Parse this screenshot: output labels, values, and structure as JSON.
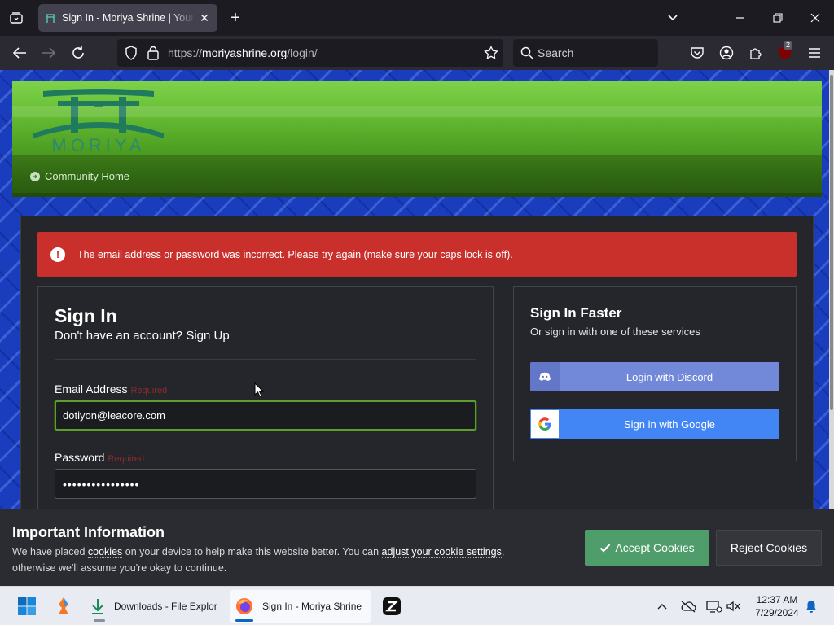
{
  "browser": {
    "tab_title": "Sign In - Moriya Shrine | Your re",
    "url_dim_prefix": "https://",
    "url_host": "moriyashrine.org",
    "url_path": "/login/",
    "search_placeholder": "Search",
    "extension_badge": "2"
  },
  "site": {
    "logo_text": "MORIYA",
    "breadcrumb": "Community Home",
    "brand_green": "#66bd33"
  },
  "alert": {
    "icon": "!",
    "message": "The email address or password was incorrect. Please try again (make sure your caps lock is off)."
  },
  "signin": {
    "title": "Sign In",
    "subtitle_prefix": "Don't have an account?",
    "signup_link": "Sign Up",
    "email_label": "Email Address",
    "email_required": "Required",
    "email_value": "dotiyon@leacore.com",
    "password_label": "Password",
    "password_required": "Required",
    "password_value": "••••••••••••••••"
  },
  "faster": {
    "title": "Sign In Faster",
    "subtitle": "Or sign in with one of these services",
    "discord_label": "Login with Discord",
    "google_label": "Sign in with Google"
  },
  "cookie": {
    "title": "Important Information",
    "text_1": "We have placed ",
    "link_cookies": "cookies",
    "text_2": " on your device to help make this website better. You can ",
    "link_settings": "adjust your cookie settings",
    "text_3": ", otherwise we'll assume you're okay to continue.",
    "accept_label": "Accept Cookies",
    "reject_label": "Reject Cookies"
  },
  "taskbar": {
    "explorer_label": "Downloads - File Explor",
    "firefox_label": "Sign In - Moriya Shrine",
    "time": "12:37 AM",
    "date": "7/29/2024"
  }
}
